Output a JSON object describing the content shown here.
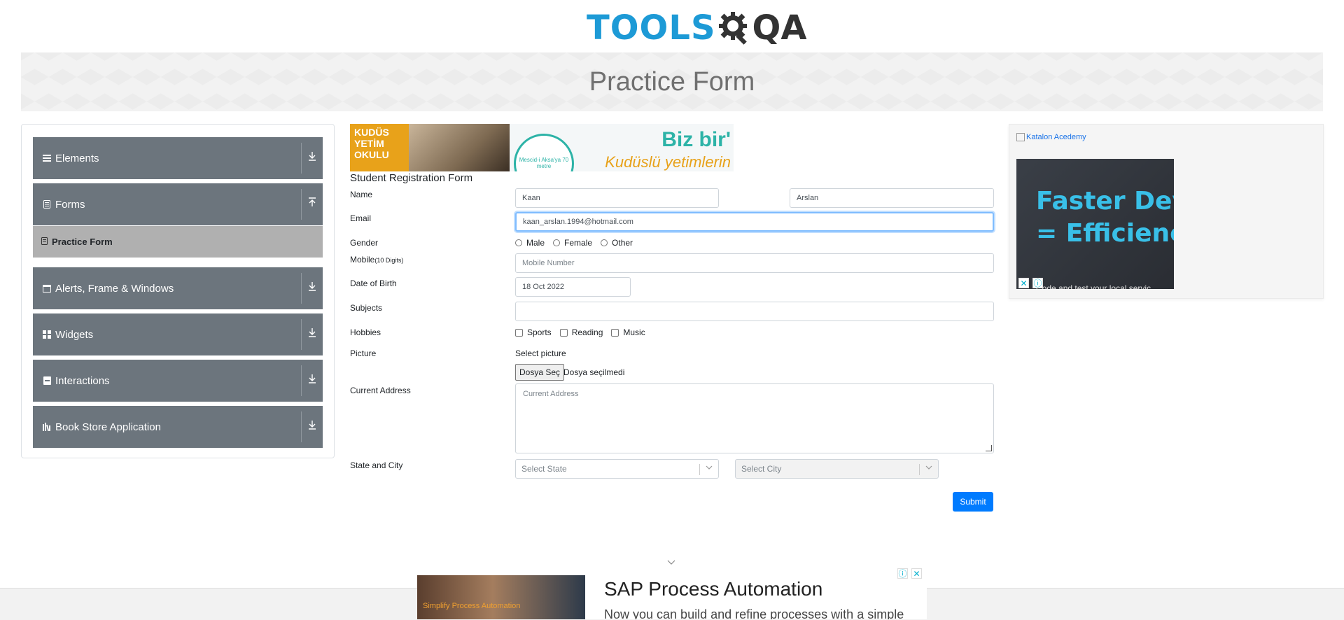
{
  "header": {
    "logo_text": "TOOLS",
    "logo_text2": "QA",
    "page_title": "Practice Form"
  },
  "sidebar": {
    "groups": [
      {
        "label": "Elements",
        "icon": "hamburger-icon",
        "arrow": "download-icon"
      },
      {
        "label": "Forms",
        "icon": "document-icon",
        "arrow": "upload-icon"
      },
      {
        "label": "Alerts, Frame & Windows",
        "icon": "window-icon",
        "arrow": "download-icon"
      },
      {
        "label": "Widgets",
        "icon": "grid-icon",
        "arrow": "download-icon"
      },
      {
        "label": "Interactions",
        "icon": "interaction-icon",
        "arrow": "download-icon"
      },
      {
        "label": "Book Store Application",
        "icon": "books-icon",
        "arrow": "download-icon"
      }
    ],
    "active_item": "Practice Form"
  },
  "top_ad": {
    "left_text": "KUDÜS YETİM OKULU",
    "pin_text": "Mescid-i Aksa'ya 70 metre",
    "headline": "Biz bir'",
    "subline": "Kudüslü yetimlerin"
  },
  "form": {
    "title": "Student Registration Form",
    "labels": {
      "name": "Name",
      "email": "Email",
      "gender": "Gender",
      "mobile": "Mobile",
      "mobile_hint": "(10 Digits)",
      "dob": "Date of Birth",
      "subjects": "Subjects",
      "hobbies": "Hobbies",
      "picture": "Picture",
      "address": "Current Address",
      "state_city": "State and City"
    },
    "first_name": "Kaan",
    "last_name": "Arslan",
    "email": "kaan_arslan.1994@hotmail.com",
    "genders": [
      "Male",
      "Female",
      "Other"
    ],
    "mobile_placeholder": "Mobile Number",
    "dob": "18 Oct 2022",
    "subjects": "",
    "hobbies": [
      "Sports",
      "Reading",
      "Music"
    ],
    "picture_label": "Select picture",
    "file_button": "Dosya Seç",
    "file_status": "Dosya seçilmedi",
    "address_placeholder": "Current Address",
    "state_placeholder": "Select State",
    "city_placeholder": "Select City",
    "submit": "Submit"
  },
  "right_ad": {
    "link_text": "Katalon Acedemy",
    "line1": "Faster Dev",
    "line2": "= Efficiency",
    "sub": "Code and test your local servic"
  },
  "bottom_ad": {
    "simplify": "Simplify",
    "simplify_rest": " Process Automation",
    "headline": "SAP Process Automation",
    "subline": "Now you can build and refine processes with a simple"
  },
  "colors": {
    "brand_blue": "#1d9ad6",
    "sidebar_bg": "#6c757d",
    "active_item_bg": "#b0b0b0",
    "submit_blue": "#007bff"
  }
}
